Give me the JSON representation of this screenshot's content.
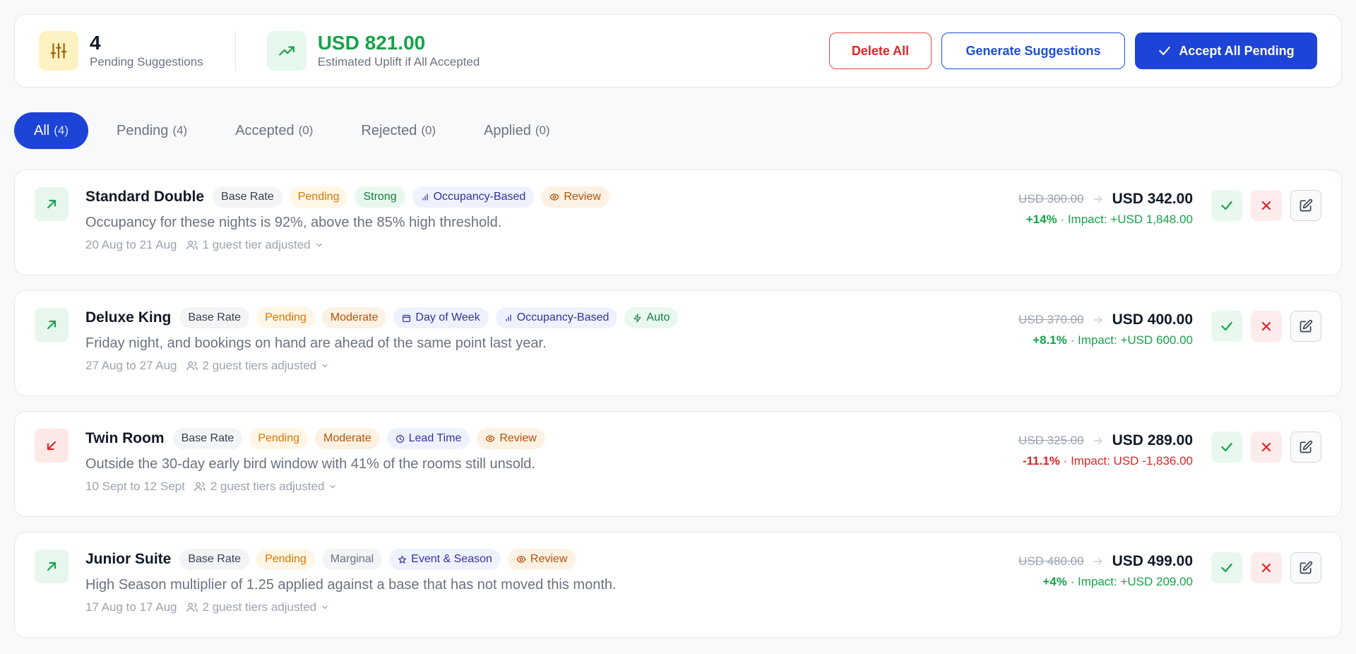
{
  "summary": {
    "pending_count": "4",
    "pending_label": "Pending Suggestions",
    "uplift_value": "USD 821.00",
    "uplift_label": "Estimated Uplift if All Accepted",
    "delete_label": "Delete All",
    "generate_label": "Generate Suggestions",
    "accept_label": "Accept All Pending"
  },
  "tabs": [
    {
      "label": "All",
      "count": "(4)"
    },
    {
      "label": "Pending",
      "count": "(4)"
    },
    {
      "label": "Accepted",
      "count": "(0)"
    },
    {
      "label": "Rejected",
      "count": "(0)"
    },
    {
      "label": "Applied",
      "count": "(0)"
    }
  ],
  "suggestions": [
    {
      "name": "Standard Double",
      "direction": "up",
      "tags": [
        "Base Rate",
        "Pending",
        "Strong",
        "Occupancy-Based",
        "Review"
      ],
      "reason": "Occupancy for these nights is 92%, above the 85% high threshold.",
      "dates": "20 Aug to 21 Aug",
      "tiers": "1 guest tier adjusted",
      "old_price": "USD 300.00",
      "new_price": "USD 342.00",
      "change": "+14%",
      "impact": "Impact: +USD 1,848.00"
    },
    {
      "name": "Deluxe King",
      "direction": "up",
      "tags": [
        "Base Rate",
        "Pending",
        "Moderate",
        "Day of Week",
        "Occupancy-Based",
        "Auto"
      ],
      "reason": "Friday night, and bookings on hand are ahead of the same point last year.",
      "dates": "27 Aug to 27 Aug",
      "tiers": "2 guest tiers adjusted",
      "old_price": "USD 370.00",
      "new_price": "USD 400.00",
      "change": "+8.1%",
      "impact": "Impact: +USD 600.00"
    },
    {
      "name": "Twin Room",
      "direction": "down",
      "tags": [
        "Base Rate",
        "Pending",
        "Moderate",
        "Lead Time",
        "Review"
      ],
      "reason": "Outside the 30-day early bird window with 41% of the rooms still unsold.",
      "dates": "10 Sept to 12 Sept",
      "tiers": "2 guest tiers adjusted",
      "old_price": "USD 325.00",
      "new_price": "USD 289.00",
      "change": "-11.1%",
      "impact": "Impact: USD -1,836.00"
    },
    {
      "name": "Junior Suite",
      "direction": "up",
      "tags": [
        "Base Rate",
        "Pending",
        "Marginal",
        "Event & Season",
        "Review"
      ],
      "reason": "High Season multiplier of 1.25 applied against a base that has not moved this month.",
      "dates": "17 Aug to 17 Aug",
      "tiers": "2 guest tiers adjusted",
      "old_price": "USD 480.00",
      "new_price": "USD 499.00",
      "change": "+4%",
      "impact": "Impact: +USD 209.00"
    }
  ],
  "separator": "·",
  "colors": {
    "accent": "#1d44d6",
    "positive": "#16a34a",
    "negative": "#dc2626"
  }
}
